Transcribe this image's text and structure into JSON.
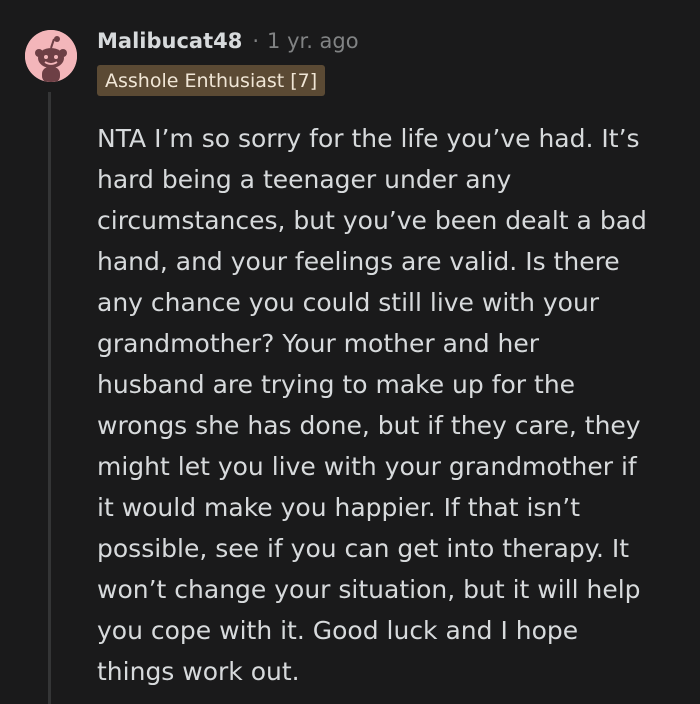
{
  "comment": {
    "username": "Malibucat48",
    "separator": "·",
    "time": "1 yr. ago",
    "flair": "Asshole Enthusiast [7]",
    "avatar_icon": "reddit-snoo-avatar-icon",
    "avatar_color": "#f3b6ba",
    "flair_color": "#5b4a34",
    "body_lines": [
      "NTA I’m so sorry for the life you’ve had. It’s",
      "hard being a teenager under any",
      "circumstances, but you’ve been dealt a bad",
      "hand, and your feelings are valid. Is there",
      "any chance you could still live with your",
      "grandmother? Your mother and her",
      "husband are trying to make up for the",
      "wrongs she has done, but if they care, they",
      "might let you live with your grandmother if",
      "it would make you happier. If that isn’t",
      "possible, see if you can get into therapy. It",
      "won’t change your situation, but it will help",
      "you cope with it. Good luck and I hope",
      "things work out."
    ]
  }
}
